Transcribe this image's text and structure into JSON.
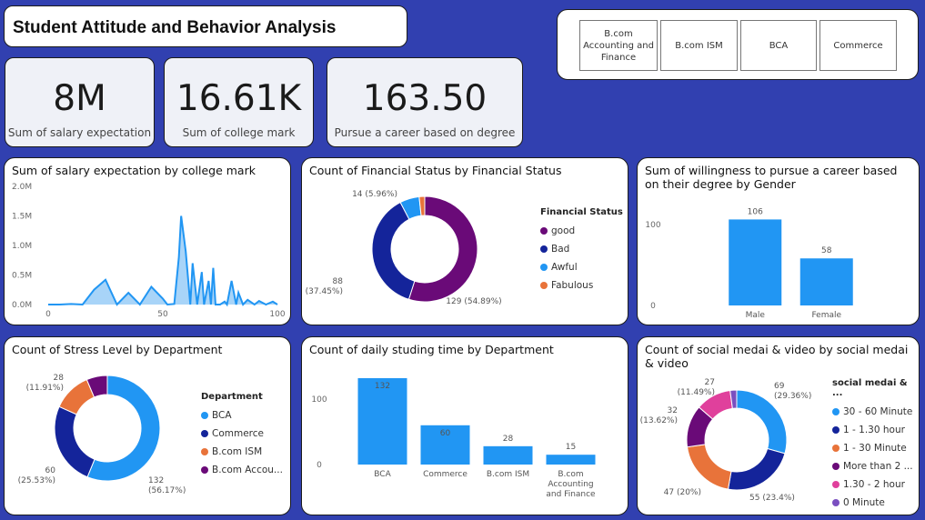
{
  "title": "Student Attitude and Behavior Analysis",
  "slicer": [
    "B.com Accounting and Finance",
    "B.com ISM",
    "BCA",
    "Commerce"
  ],
  "kpis": [
    {
      "value": "8M",
      "label": "Sum of salary expectation"
    },
    {
      "value": "16.61K",
      "label": "Sum of college mark"
    },
    {
      "value": "163.50",
      "label": "Pursue a career based on degree"
    }
  ],
  "colors": {
    "blue": "#2196f3",
    "navy": "#14249a",
    "orange": "#e8733a",
    "purple": "#6a0a78",
    "pink": "#e0409c",
    "violet": "#7a4fc0",
    "area": "#a8d4f8"
  },
  "chart_data": [
    {
      "type": "area",
      "title": "Sum of salary expectation by college mark",
      "x_ticks": [
        "0",
        "50",
        "100"
      ],
      "y_ticks": [
        "0.0M",
        "0.5M",
        "1.0M",
        "1.5M",
        "2.0M"
      ],
      "xlim": [
        0,
        100
      ],
      "ylim": [
        0,
        2000000
      ],
      "x": [
        0,
        5,
        10,
        15,
        20,
        25,
        30,
        35,
        40,
        45,
        50,
        52,
        55,
        57,
        58,
        60,
        62,
        63,
        65,
        67,
        68,
        70,
        71,
        72,
        73,
        75,
        77,
        78,
        80,
        82,
        83,
        85,
        87,
        90,
        92,
        95,
        98,
        100
      ],
      "values": [
        0,
        0,
        10000,
        0,
        250000,
        420000,
        0,
        200000,
        0,
        300000,
        100000,
        0,
        10000,
        800000,
        1500000,
        900000,
        0,
        700000,
        0,
        550000,
        0,
        400000,
        0,
        620000,
        0,
        0,
        50000,
        0,
        400000,
        0,
        200000,
        0,
        80000,
        0,
        60000,
        0,
        50000,
        0
      ]
    },
    {
      "type": "pie",
      "title": "Count of Financial Status by Financial Status",
      "legend_title": "Financial Status",
      "categories": [
        "good",
        "Bad",
        "Awful",
        "Fabulous"
      ],
      "values": [
        129,
        88,
        14,
        4
      ],
      "labels": [
        "129 (54.89%)",
        "88\n(37.45%)",
        "14 (5.96%)",
        ""
      ],
      "colors": [
        "#6a0a78",
        "#14249a",
        "#2196f3",
        "#e8733a"
      ]
    },
    {
      "type": "bar",
      "title": "Sum of willingness to pursue a career based on their degree by Gender",
      "categories": [
        "Male",
        "Female"
      ],
      "values": [
        106,
        58
      ],
      "y_ticks": [
        "0",
        "100"
      ],
      "ylim": [
        0,
        130
      ]
    },
    {
      "type": "pie",
      "title": "Count of Stress Level by Department",
      "legend_title": "Department",
      "categories": [
        "BCA",
        "Commerce",
        "B.com ISM",
        "B.com Accou..."
      ],
      "values": [
        132,
        60,
        28,
        15
      ],
      "labels": [
        "132\n(56.17%)",
        "60\n(25.53%)",
        "28\n(11.91%)",
        ""
      ],
      "colors": [
        "#2196f3",
        "#14249a",
        "#e8733a",
        "#6a0a78"
      ]
    },
    {
      "type": "bar",
      "title": "Count of daily studing time by Department",
      "categories": [
        "BCA",
        "Commerce",
        "B.com ISM",
        "B.com\nAccounting\nand Finance"
      ],
      "values": [
        132,
        60,
        28,
        15
      ],
      "y_ticks": [
        "0",
        "100"
      ],
      "ylim": [
        0,
        150
      ]
    },
    {
      "type": "pie",
      "title": "Count of social medai & video by social medai & video",
      "legend_title": "social medai & ...",
      "categories": [
        "30 - 60 Minute",
        "1 - 1.30 hour",
        "1 - 30 Minute",
        "More than 2 ...",
        "1.30 - 2 hour",
        "0 Minute"
      ],
      "values": [
        69,
        55,
        47,
        32,
        27,
        5
      ],
      "labels": [
        "69\n(29.36%)",
        "55 (23.4%)",
        "47 (20%)",
        "32\n(13.62%)",
        "27\n(11.49%)",
        ""
      ],
      "colors": [
        "#2196f3",
        "#14249a",
        "#e8733a",
        "#6a0a78",
        "#e0409c",
        "#7a4fc0"
      ]
    }
  ]
}
